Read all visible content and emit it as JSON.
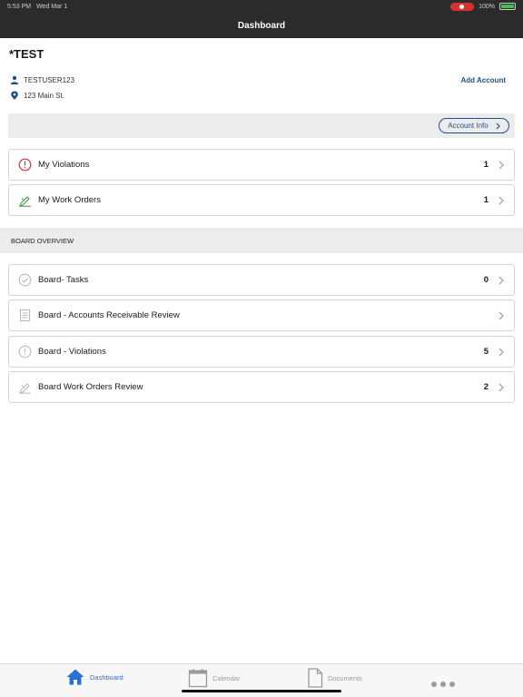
{
  "status": {
    "time": "5:53 PM",
    "date": "Wed Mar 1",
    "battery": "100%"
  },
  "nav": {
    "title": "Dashboard"
  },
  "account": {
    "name": "*TEST",
    "user": "TESTUSER123",
    "address": "123 Main St.",
    "add_account_label": "Add Account",
    "account_info_label": "Account Info"
  },
  "my_items": [
    {
      "label": "My Violations",
      "count": "1"
    },
    {
      "label": "My Work Orders",
      "count": "1"
    }
  ],
  "board": {
    "section_title": "BOARD OVERVIEW",
    "items": [
      {
        "label": "Board- Tasks",
        "count": "0"
      },
      {
        "label": "Board - Accounts Receivable Review",
        "count": ""
      },
      {
        "label": "Board - Violations",
        "count": "5"
      },
      {
        "label": "Board Work Orders Review",
        "count": "2"
      }
    ]
  },
  "tabs": [
    {
      "label": "Dashboard",
      "icon": "home-icon",
      "active": true
    },
    {
      "label": "Calendar",
      "icon": "calendar-icon",
      "active": false
    },
    {
      "label": "Documents",
      "icon": "document-icon",
      "active": false
    },
    {
      "label": "",
      "icon": "more-icon",
      "active": false
    }
  ],
  "colors": {
    "accent": "#1f4f8a",
    "tab_active": "#2c6fd6",
    "violation_red": "#d9322e",
    "work_green": "#3f9a3c",
    "header": "#2b2b2b"
  }
}
